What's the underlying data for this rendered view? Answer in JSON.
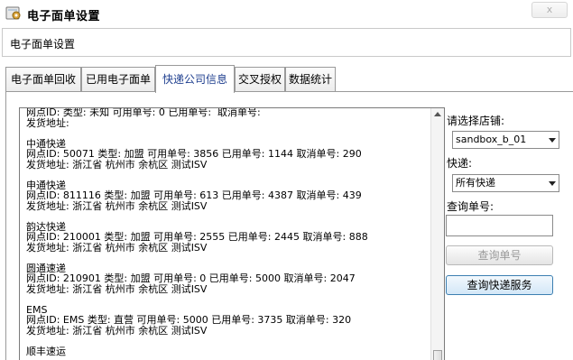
{
  "window": {
    "title": "电子面单设置",
    "close_label": "x"
  },
  "header": {
    "title": "电子面单设置"
  },
  "tabs": [
    {
      "label": "电子面单回收",
      "active": false
    },
    {
      "label": "已用电子面单",
      "active": false
    },
    {
      "label": "快递公司信息",
      "active": true
    },
    {
      "label": "交叉授权",
      "active": false
    },
    {
      "label": "数据统计",
      "active": false
    }
  ],
  "content": {
    "lines": [
      "网点ID: 类型: 未知 可用单号: 0 已用单号:  取消单号:",
      "发货地址:",
      "",
      "中通快递",
      "网点ID: 50071 类型: 加盟 可用单号: 3856 已用单号: 1144 取消单号: 290",
      "发货地址: 浙江省 杭州市 余杭区 测试ISV",
      "",
      "申通快递",
      "网点ID: 811116 类型: 加盟 可用单号: 613 已用单号: 4387 取消单号: 439",
      "发货地址: 浙江省 杭州市 余杭区 测试ISV",
      "",
      "韵达快递",
      "网点ID: 210001 类型: 加盟 可用单号: 2555 已用单号: 2445 取消单号: 888",
      "发货地址: 浙江省 杭州市 余杭区 测试ISV",
      "",
      "圆通速递",
      "网点ID: 210901 类型: 加盟 可用单号: 0 已用单号: 5000 取消单号: 2047",
      "发货地址: 浙江省 杭州市 余杭区 测试ISV",
      "",
      "EMS",
      "网点ID: EMS 类型: 直营 可用单号: 5000 已用单号: 3735 取消单号: 320",
      "发货地址: 浙江省 杭州市 余杭区 测试ISV",
      "",
      "顺丰速运"
    ]
  },
  "sidebar": {
    "store_label": "请选择店铺:",
    "store_value": "sandbox_b_01",
    "express_label": "快递:",
    "express_value": "所有快递",
    "query_label": "查询单号:",
    "query_value": "",
    "query_button": "查询单号",
    "query_express_button": "查询快递服务"
  }
}
